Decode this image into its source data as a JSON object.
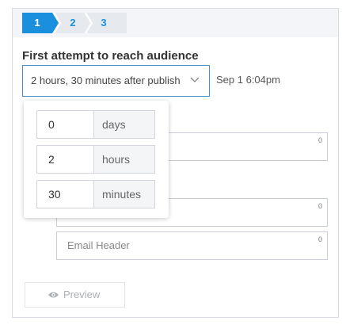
{
  "steps": [
    "1",
    "2",
    "3"
  ],
  "colors": {
    "active_step": "#1a8fdd",
    "inactive_step_text": "#1a8fdd",
    "select_border": "#4a90c6"
  },
  "heading": "First attempt to reach audience",
  "delay_select": {
    "value": "2 hours, 30 minutes after publish",
    "icon": "chevron-down-icon"
  },
  "send_time": "Sep 1 6:04pm",
  "fields": [
    {
      "counter": "0",
      "placeholder": ""
    },
    {
      "counter": "0",
      "placeholder": ""
    },
    {
      "counter": "0",
      "placeholder": "Email Header"
    }
  ],
  "preview": {
    "label": "Preview",
    "icon": "eye-icon"
  },
  "delay_popover": {
    "days": {
      "value": "0",
      "unit": "days"
    },
    "hours": {
      "value": "2",
      "unit": "hours"
    },
    "minutes": {
      "value": "30",
      "unit": "minutes"
    }
  }
}
